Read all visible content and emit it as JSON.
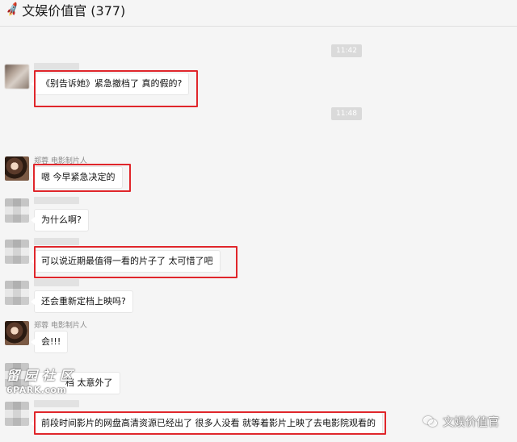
{
  "header": {
    "title": "文娱价值官 (377)"
  },
  "timestamps": [
    "11:42",
    "11:48"
  ],
  "messages": [
    {
      "sender": "",
      "text": "《别告诉她》紧急撤档了 真的假的?"
    },
    {
      "sender": "郑蓉 电影制片人",
      "text": "嗯 今早紧急决定的"
    },
    {
      "sender": "",
      "text": "为什么啊?"
    },
    {
      "sender": "",
      "text": "可以说近期最值得一看的片子了 太可惜了吧"
    },
    {
      "sender": "",
      "text": "还会重新定档上映吗?"
    },
    {
      "sender": "郑蓉 电影制片人",
      "text": "会!!!"
    },
    {
      "sender": "",
      "text": "档 太意外了"
    },
    {
      "sender": "",
      "text": "前段时间影片的网盘高清资源已经出了 很多人没看 就等着影片上映了去电影院观看的"
    }
  ],
  "watermarks": {
    "left_cn": "留园社区",
    "left_en": "6PARK.com",
    "right": "文娱价值官"
  },
  "colors": {
    "highlight": "#e0262b",
    "background": "#f5f5f5",
    "bubble": "#ffffff",
    "timestamp_bg": "#dadada"
  },
  "icons": {
    "header": "rocket-icon",
    "right_watermark": "wechat-icon"
  }
}
